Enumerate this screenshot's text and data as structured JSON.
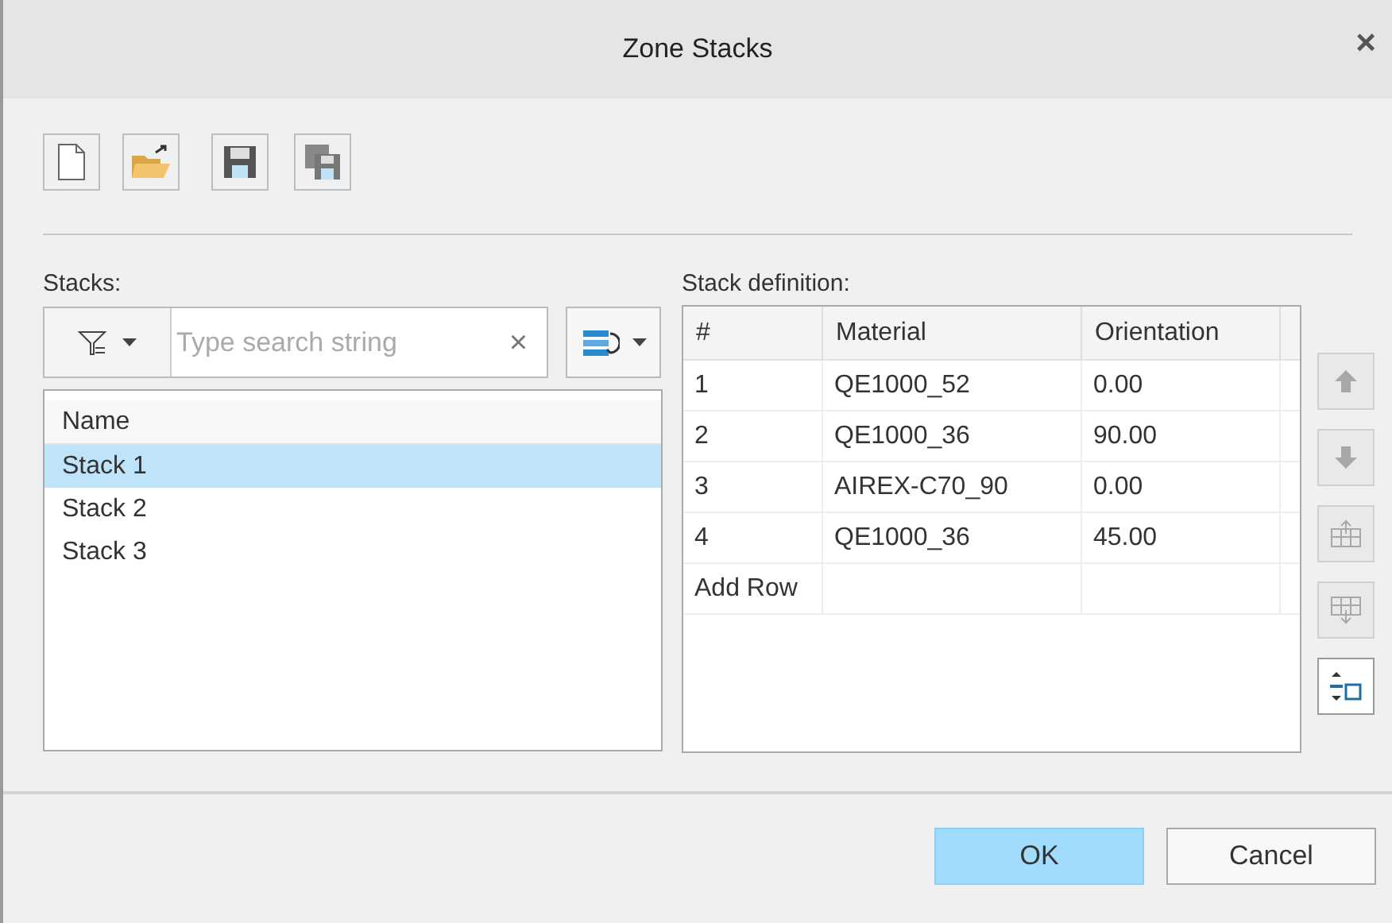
{
  "window": {
    "title": "Zone Stacks",
    "close": "×"
  },
  "stacks": {
    "label": "Stacks:",
    "search": {
      "placeholder": "Type search string",
      "clear": "×"
    },
    "list_header": "Name",
    "items": [
      {
        "name": "Stack 1",
        "selected": true
      },
      {
        "name": "Stack 2",
        "selected": false
      },
      {
        "name": "Stack 3",
        "selected": false
      }
    ]
  },
  "definition": {
    "label": "Stack definition:",
    "columns": [
      "#",
      "Material",
      "Orientation"
    ],
    "rows": [
      [
        "1",
        "QE1000_52",
        "0.00"
      ],
      [
        "2",
        "QE1000_36",
        "90.00"
      ],
      [
        "3",
        "AIREX-C70_90",
        "0.00"
      ],
      [
        "4",
        "QE1000_36",
        "45.00"
      ]
    ],
    "add_row": "Add Row",
    "side_buttons": [
      {
        "kind": "up",
        "disabled": true
      },
      {
        "kind": "down",
        "disabled": true
      },
      {
        "kind": "insert-above",
        "disabled": true
      },
      {
        "kind": "insert-below",
        "disabled": true
      },
      {
        "kind": "spacing",
        "disabled": false
      }
    ]
  },
  "buttons": [
    {
      "label": "OK",
      "default": true
    },
    {
      "label": "Cancel",
      "default": false
    }
  ]
}
